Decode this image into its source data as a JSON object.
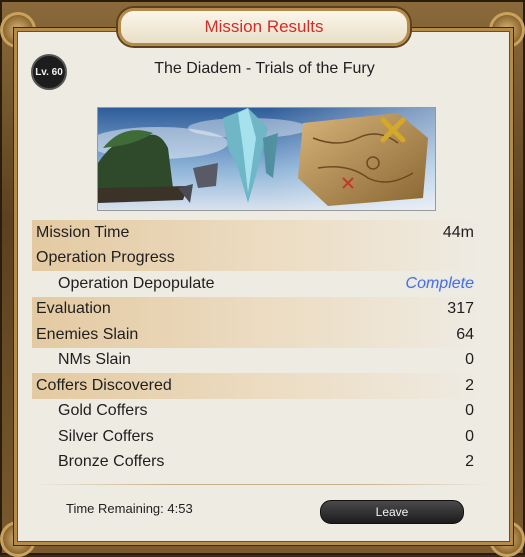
{
  "window": {
    "title": "Mission Results"
  },
  "duty": {
    "level_badge": "Lv. 60",
    "name": "The Diadem - Trials of the Fury"
  },
  "results": [
    {
      "label": "Mission Time",
      "value": "44m",
      "highlight": true,
      "sub": false
    },
    {
      "label": "Operation Progress",
      "value": "",
      "highlight": true,
      "sub": false
    },
    {
      "label": "Operation Depopulate",
      "value": "Complete",
      "highlight": false,
      "sub": true,
      "status": true
    },
    {
      "label": "Evaluation",
      "value": "317",
      "highlight": true,
      "sub": false
    },
    {
      "label": "Enemies Slain",
      "value": "64",
      "highlight": true,
      "sub": false
    },
    {
      "label": "NMs Slain",
      "value": "0",
      "highlight": false,
      "sub": true
    },
    {
      "label": "Coffers Discovered",
      "value": "2",
      "highlight": true,
      "sub": false
    },
    {
      "label": "Gold Coffers",
      "value": "0",
      "highlight": false,
      "sub": true
    },
    {
      "label": "Silver Coffers",
      "value": "0",
      "highlight": false,
      "sub": true
    },
    {
      "label": "Bronze Coffers",
      "value": "2",
      "highlight": false,
      "sub": true
    }
  ],
  "footer": {
    "time_remaining": "Time Remaining: 4:53",
    "leave_label": "Leave"
  },
  "colors": {
    "title_red": "#d42b2b",
    "complete_blue": "#4a6fd6",
    "frame_gold": "#b58b4a"
  }
}
